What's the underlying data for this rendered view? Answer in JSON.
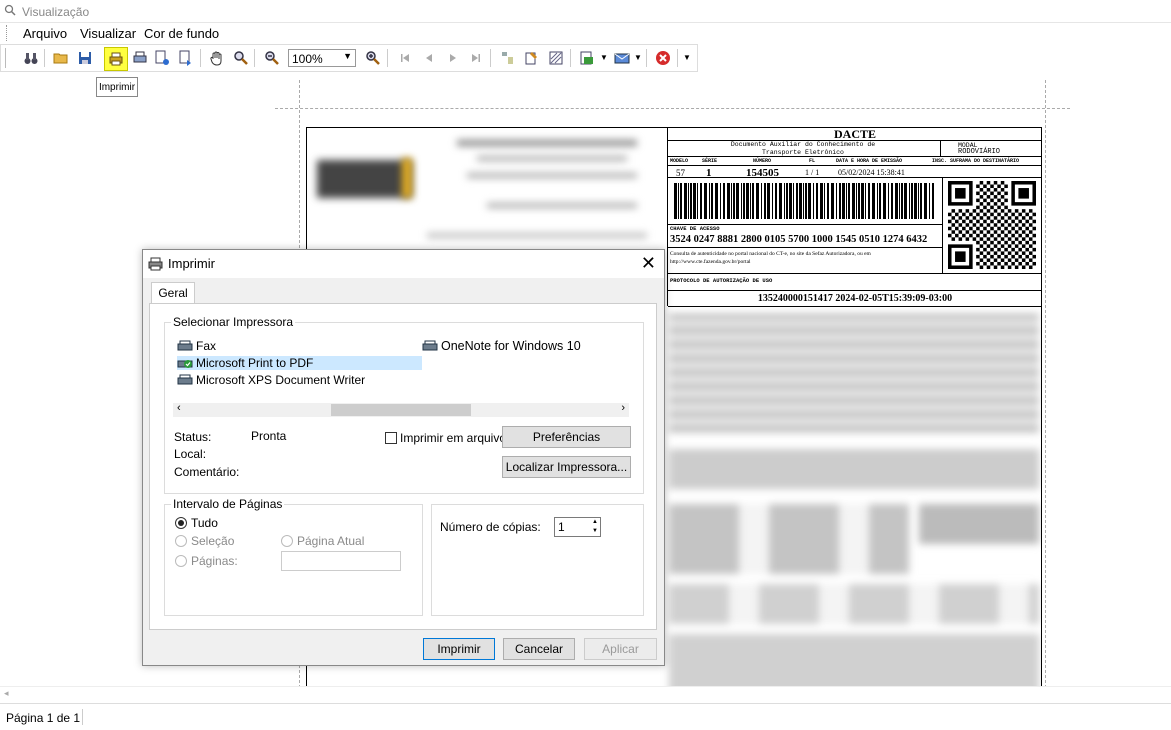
{
  "window": {
    "title": "Visualização"
  },
  "menu": {
    "items": [
      "Arquivo",
      "Visualizar",
      "Cor de fundo"
    ]
  },
  "toolbar": {
    "zoom_value": "100%",
    "tooltip": "Imprimir"
  },
  "status": {
    "page": "Página 1 de 1"
  },
  "document": {
    "title": "DACTE",
    "subtitle": "Documento Auxiliar do Conhecimento de Transporte Eletrônico",
    "modal_label": "MODAL",
    "modal_value": "RODOVIÁRIO",
    "headers": [
      "MODELO",
      "SÉRIE",
      "NÚMERO",
      "FL",
      "DATA E HORA DE EMISSÃO",
      "INSC. SUFRAMA DO DESTINATÁRIO"
    ],
    "values": [
      "57",
      "1",
      "154505",
      "1 / 1",
      "05/02/2024 15:38:41",
      ""
    ],
    "chave_label": "CHAVE DE ACESSO",
    "chave_value": "3524 0247 8881 2800 0105 5700 1000 1545 0510 1274 6432",
    "consulta_text": "Consulta de autenticidade no portal nacional do CT-e, no site da Sefaz Autorizadora, ou em http://www.cte.fazenda.gov.br/portal",
    "protocolo_label": "PROTOCOLO DE AUTORIZAÇÃO DE USO",
    "protocolo_value": "135240000151417 2024-02-05T15:39:09-03:00"
  },
  "dialog": {
    "title": "Imprimir",
    "close": "✕",
    "tab": "Geral",
    "printer_group": "Selecionar Impressora",
    "printers": [
      "Fax",
      "Microsoft Print to PDF",
      "Microsoft XPS Document Writer",
      "OneNote for Windows 10"
    ],
    "status_label": "Status:",
    "status_value": "Pronta",
    "local_label": "Local:",
    "comment_label": "Comentário:",
    "print_to_file": "Imprimir em arquivo",
    "preferences": "Preferências",
    "find_printer": "Localizar Impressora...",
    "range_group": "Intervalo de Páginas",
    "range_all": "Tudo",
    "range_selection": "Seleção",
    "range_current": "Página Atual",
    "range_pages": "Páginas:",
    "copies_label": "Número de cópias:",
    "copies_value": "1",
    "btn_print": "Imprimir",
    "btn_cancel": "Cancelar",
    "btn_apply": "Aplicar"
  }
}
